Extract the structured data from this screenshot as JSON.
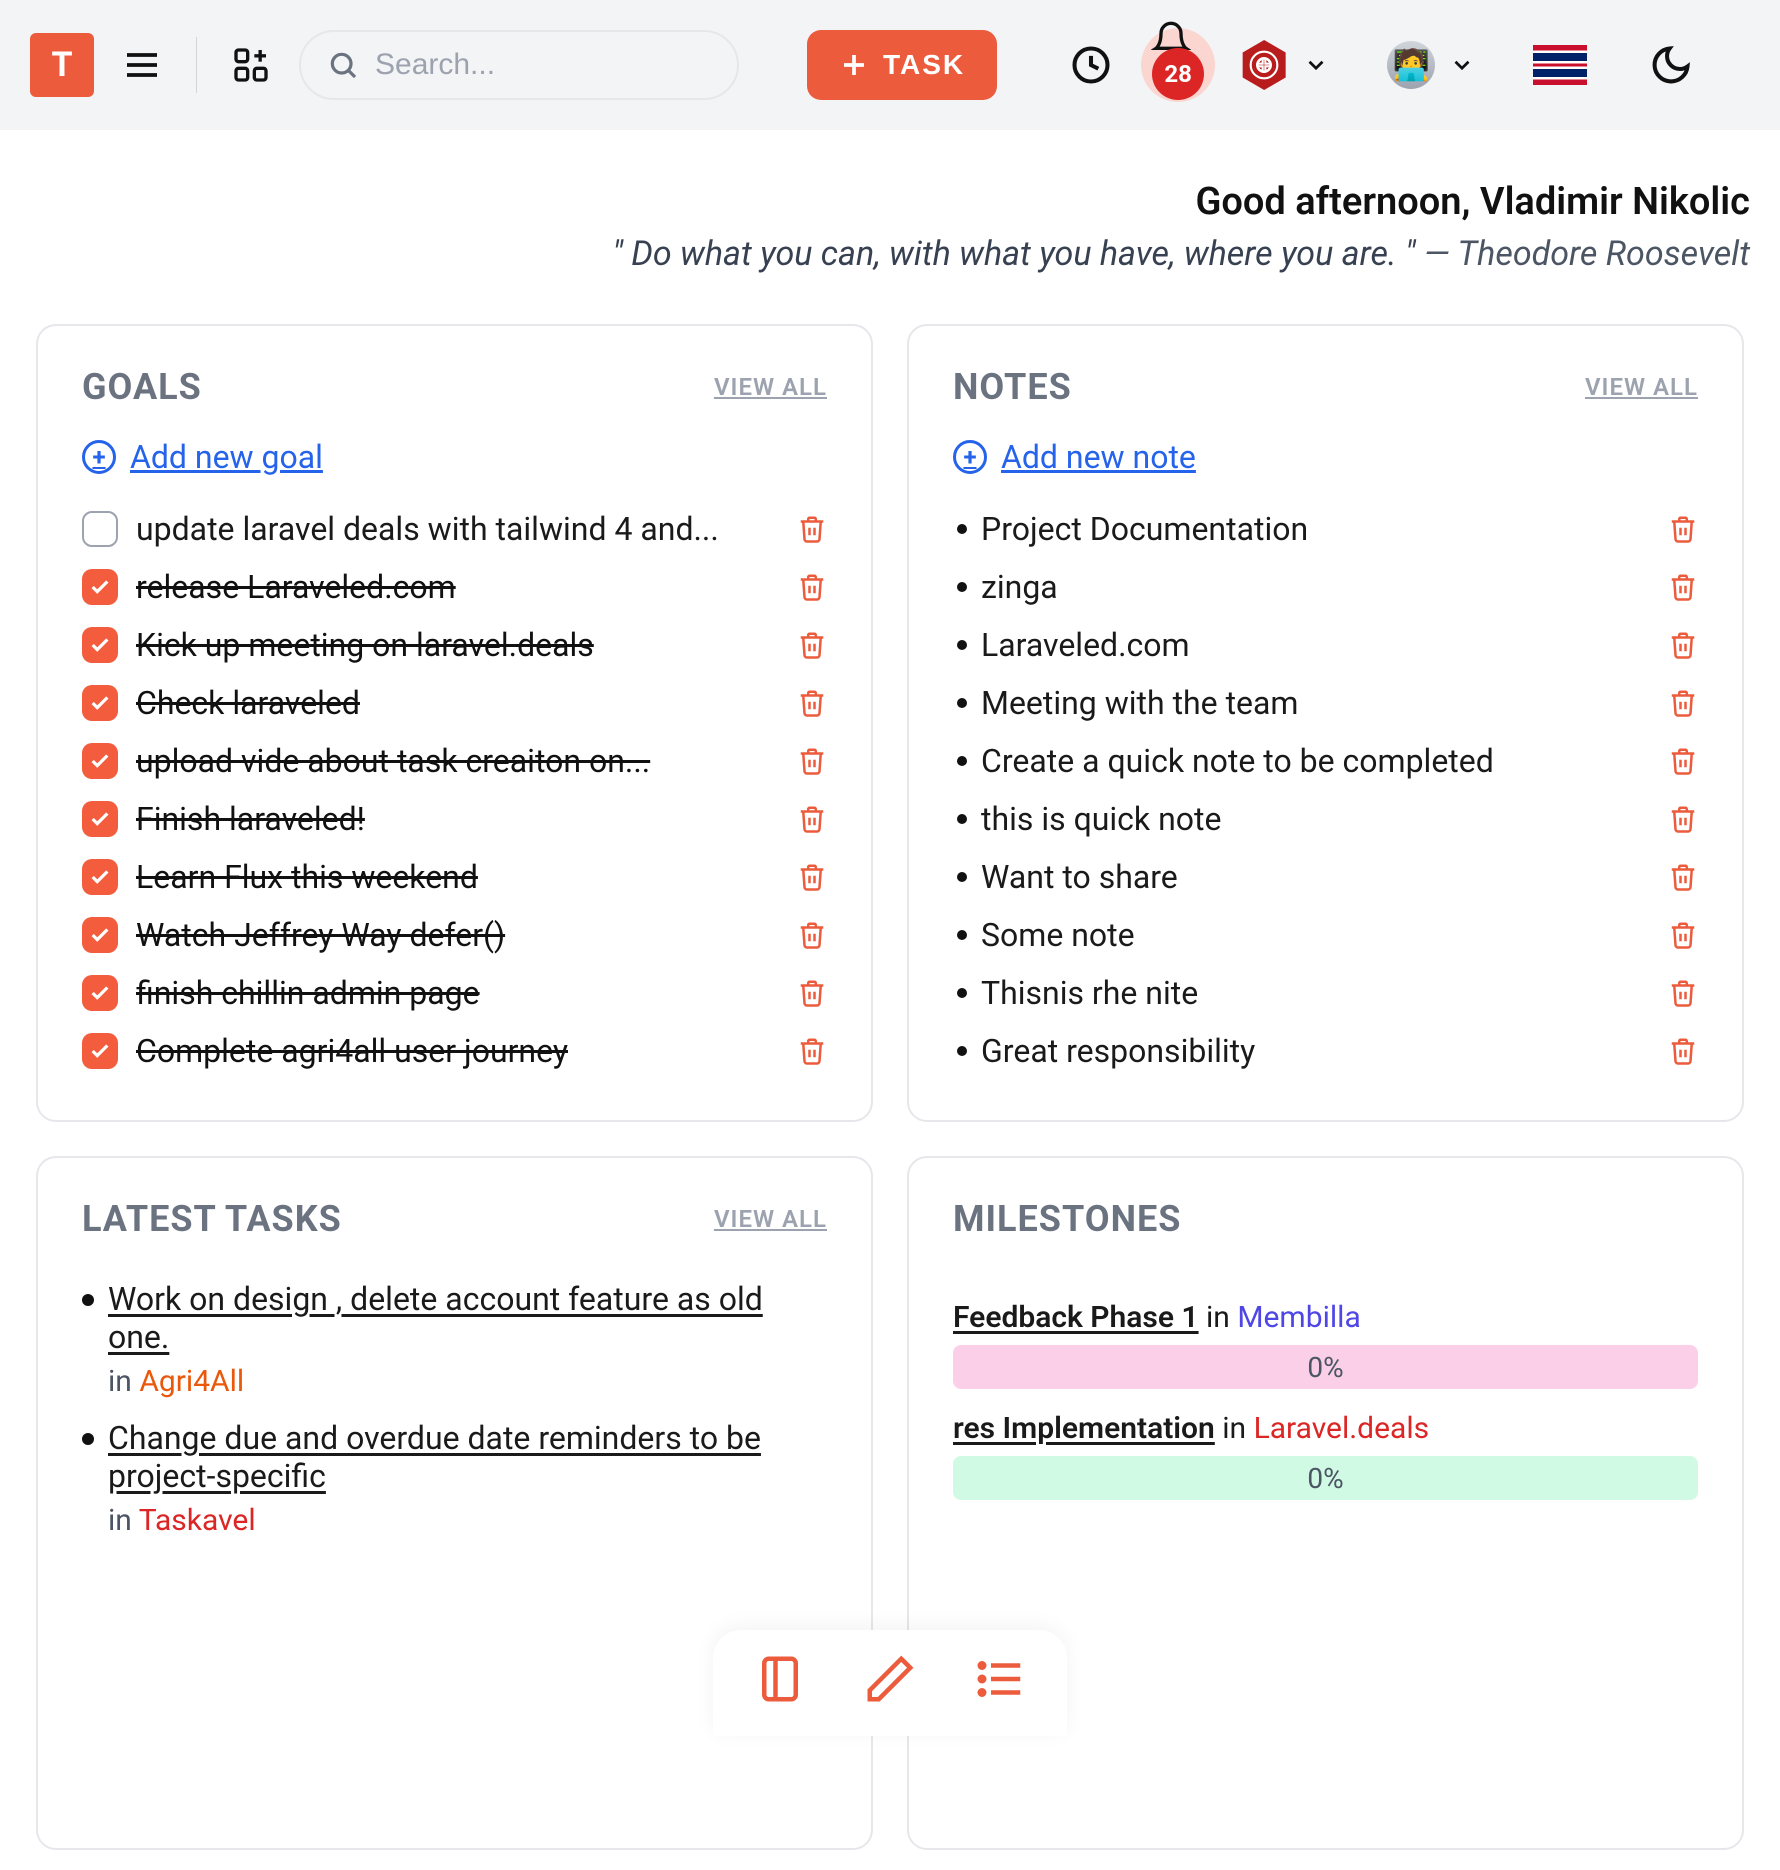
{
  "header": {
    "logo_letter": "T",
    "search_placeholder": "Search...",
    "task_button": "TASK",
    "notification_count": "28"
  },
  "greeting": {
    "line": "Good afternoon, Vladimir Nikolic",
    "quote_text": "\" Do what you can, with what you have, where you are. \"",
    "quote_author": "— Theodore Roosevelt"
  },
  "goals_card": {
    "title": "GOALS",
    "view_all": "VIEW ALL",
    "add_link": "Add new goal",
    "items": [
      {
        "text": "update laravel deals with tailwind 4 and...",
        "done": false
      },
      {
        "text": "release Laraveled.com",
        "done": true
      },
      {
        "text": "Kick up meeting on laravel.deals",
        "done": true
      },
      {
        "text": "Check laraveled",
        "done": true
      },
      {
        "text": "upload vide about task creaiton on...",
        "done": true
      },
      {
        "text": "Finish laraveled!",
        "done": true
      },
      {
        "text": "Learn Flux this weekend",
        "done": true
      },
      {
        "text": "Watch Jeffrey Way defer()",
        "done": true
      },
      {
        "text": "finish chillin admin page",
        "done": true
      },
      {
        "text": "Complete agri4all user journey",
        "done": true
      }
    ]
  },
  "notes_card": {
    "title": "NOTES",
    "view_all": "VIEW ALL",
    "add_link": "Add new note",
    "items": [
      {
        "text": "Project Documentation"
      },
      {
        "text": "zinga"
      },
      {
        "text": "Laraveled.com"
      },
      {
        "text": "Meeting with the team"
      },
      {
        "text": "Create a quick note to be completed"
      },
      {
        "text": "this is quick note"
      },
      {
        "text": "Want to share"
      },
      {
        "text": "Some note"
      },
      {
        "text": "Thisnis rhe nite"
      },
      {
        "text": "Great responsibility"
      }
    ]
  },
  "tasks_card": {
    "title": "LATEST TASKS",
    "view_all": "VIEW ALL",
    "items": [
      {
        "title": "Work on design , delete account feature as old one.",
        "in": "in ",
        "project": "Agri4All",
        "color": "orange"
      },
      {
        "title": "Change due and overdue date reminders to be project-specific",
        "in": "in ",
        "project": "Taskavel",
        "color": "red"
      }
    ]
  },
  "milestones_card": {
    "title": "MILESTONES",
    "items": [
      {
        "name": "Feedback Phase 1",
        "in": "in ",
        "project": "Membilla",
        "pcolor": "blue",
        "percent": "0%",
        "bar": "pink"
      },
      {
        "name": "res Implementation",
        "in": "in ",
        "project": "Laravel.deals",
        "pcolor": "red",
        "percent": "0%",
        "bar": "green"
      }
    ]
  }
}
